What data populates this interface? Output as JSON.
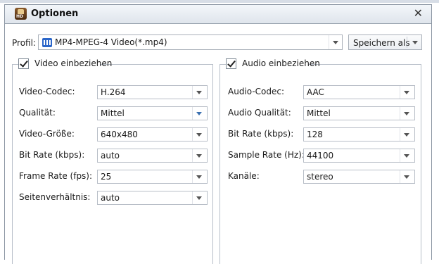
{
  "window": {
    "title": "Optionen"
  },
  "profil": {
    "label": "Profil:",
    "value": "MP4-MPEG-4 Video(*.mp4)",
    "save_as": "Speichern als"
  },
  "video": {
    "legend": "Video einbeziehen",
    "checked": true,
    "rows": [
      {
        "label": "Video-Codec:",
        "value": "H.264"
      },
      {
        "label": "Qualität:",
        "value": "Mittel"
      },
      {
        "label": "Video-Größe:",
        "value": "640x480"
      },
      {
        "label": "Bit Rate (kbps):",
        "value": "auto"
      },
      {
        "label": "Frame Rate (fps):",
        "value": "25"
      },
      {
        "label": "Seitenverhältnis:",
        "value": "auto"
      }
    ]
  },
  "audio": {
    "legend": "Audio einbeziehen",
    "checked": true,
    "rows": [
      {
        "label": "Audio-Codec:",
        "value": "AAC"
      },
      {
        "label": "Audio Qualität:",
        "value": "Mittel"
      },
      {
        "label": "Bit Rate (kbps):",
        "value": "128"
      },
      {
        "label": "Sample Rate (Hz):",
        "value": "44100"
      },
      {
        "label": "Kanäle:",
        "value": "stereo"
      }
    ]
  },
  "icons": {
    "app": "app-hd-icon",
    "close": "close-icon",
    "profile": "video-file-icon",
    "dropdown": "chevron-down-icon",
    "checkbox": "checkmark-icon"
  }
}
